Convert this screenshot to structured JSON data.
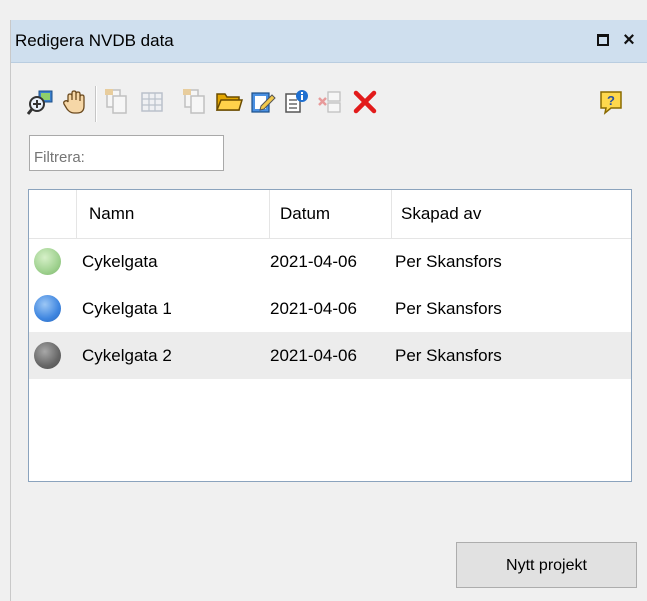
{
  "window": {
    "title": "Redigera NVDB data",
    "restore_glyph": "",
    "close_glyph": "×"
  },
  "toolbar": {
    "buttons": [
      {
        "icon": "zoom-to-layer-icon",
        "enabled": true
      },
      {
        "icon": "pan-hand-icon",
        "enabled": true
      },
      {
        "icon": "copy-feature-icon",
        "enabled": false
      },
      {
        "icon": "attribute-table-icon",
        "enabled": false
      },
      {
        "icon": "paste-feature-icon",
        "enabled": false
      },
      {
        "icon": "open-folder-icon",
        "enabled": true
      },
      {
        "icon": "edit-project-icon",
        "enabled": true
      },
      {
        "icon": "project-info-icon",
        "enabled": true
      },
      {
        "icon": "remove-layer-icon",
        "enabled": false
      },
      {
        "icon": "delete-icon",
        "enabled": true
      },
      {
        "icon": "help-icon",
        "enabled": true
      }
    ]
  },
  "filter": {
    "placeholder": "Filtrera:"
  },
  "list": {
    "columns": [
      "Namn",
      "Datum",
      "Skapad av"
    ],
    "rows": [
      {
        "name": "Cykelgata",
        "date": "2021-04-06",
        "author": "Per Skansfors",
        "color": "#9fd18f",
        "selected": false
      },
      {
        "name": "Cykelgata 1",
        "date": "2021-04-06",
        "author": "Per Skansfors",
        "color": "#3f86e0",
        "selected": false
      },
      {
        "name": "Cykelgata 2",
        "date": "2021-04-06",
        "author": "Per Skansfors",
        "color": "#666666",
        "selected": true
      }
    ]
  },
  "actions": {
    "new_project_label": "Nytt projekt"
  },
  "colors": {
    "titlebar": "#cfdfee",
    "delete": "#e21b1b",
    "folder": "#f2b705",
    "list_border": "#8ba3bd"
  }
}
